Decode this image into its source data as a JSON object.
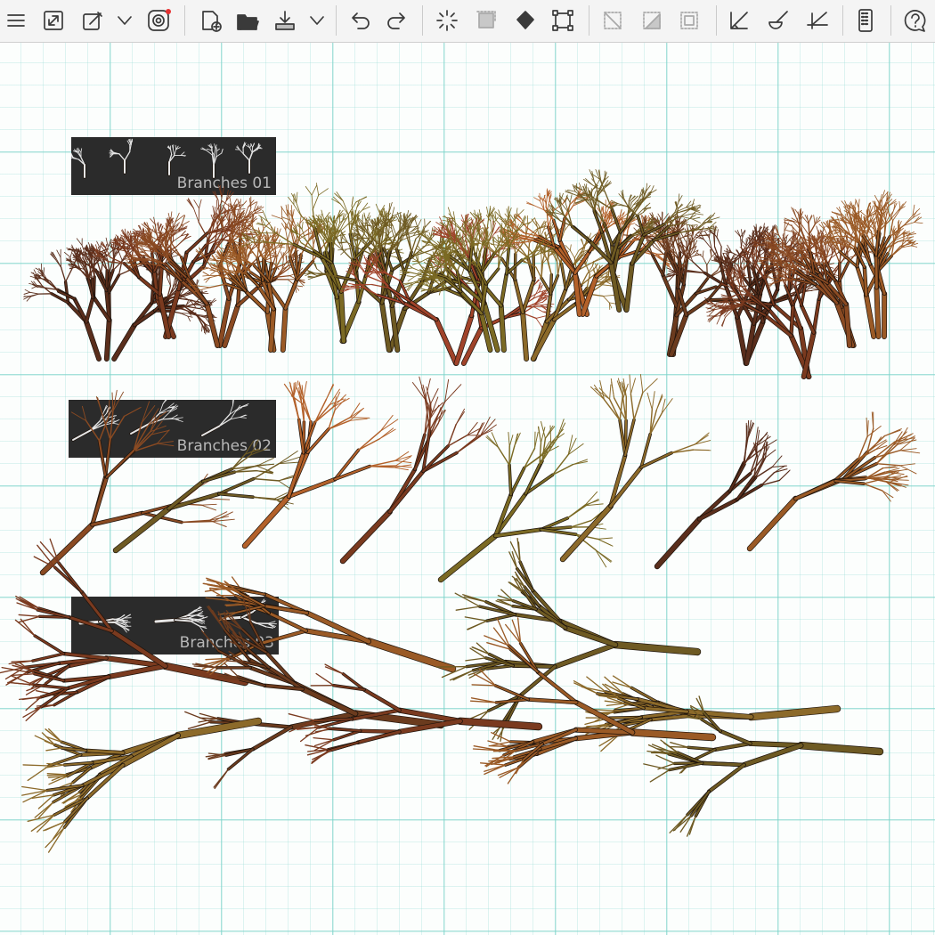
{
  "toolbar": {
    "items": [
      {
        "name": "menu-icon"
      },
      {
        "name": "resize-canvas-icon"
      },
      {
        "name": "brush-settings-icon"
      },
      {
        "name": "chevron-down-icon"
      },
      {
        "name": "companion-icon"
      },
      {
        "name": "new-canvas-icon"
      },
      {
        "name": "open-file-icon"
      },
      {
        "name": "save-icon"
      },
      {
        "name": "chevron-down-icon"
      },
      {
        "name": "undo-icon"
      },
      {
        "name": "redo-icon"
      },
      {
        "name": "loading-icon"
      },
      {
        "name": "select-all-icon"
      },
      {
        "name": "fill-bucket-icon"
      },
      {
        "name": "transform-icon"
      },
      {
        "name": "deselect-icon"
      },
      {
        "name": "invert-selection-icon"
      },
      {
        "name": "clip-selection-icon"
      },
      {
        "name": "ruler-icon"
      },
      {
        "name": "stroke-icon"
      },
      {
        "name": "crop-icon"
      },
      {
        "name": "smart-device-icon"
      },
      {
        "name": "help-icon"
      }
    ]
  },
  "brushes": [
    {
      "label": "Branches 01"
    },
    {
      "label": "Branches 02"
    },
    {
      "label": "Branches 03"
    }
  ],
  "colors": {
    "accent_dot": "#e63232",
    "grid": "#7fd4c8",
    "preview_bg": "#2b2b2b",
    "branch_palette": [
      "#5a2e1c",
      "#7a3a1f",
      "#8a4a22",
      "#9a5a26",
      "#7b6a24",
      "#6e5a23",
      "#a0432a",
      "#8c6a2a",
      "#b3612a",
      "#6b3b1e"
    ]
  }
}
